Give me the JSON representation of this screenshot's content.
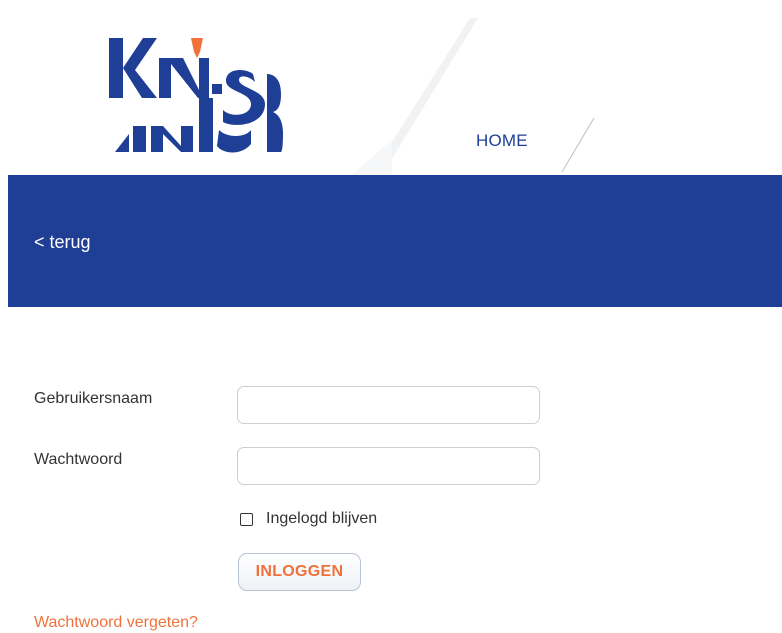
{
  "header": {
    "logo_text": "KNSB",
    "nav": {
      "home_label": "HOME"
    }
  },
  "banner": {
    "back_label": "< terug"
  },
  "login_form": {
    "username_label": "Gebruikersnaam",
    "username_value": "",
    "password_label": "Wachtwoord",
    "password_value": "",
    "remember_label": "Ingelogd blijven",
    "remember_checked": false,
    "submit_label": "INLOGGEN",
    "forgot_label": "Wachtwoord vergeten?"
  },
  "colors": {
    "brand_blue": "#1f3f96",
    "accent_orange": "#f0713a"
  }
}
